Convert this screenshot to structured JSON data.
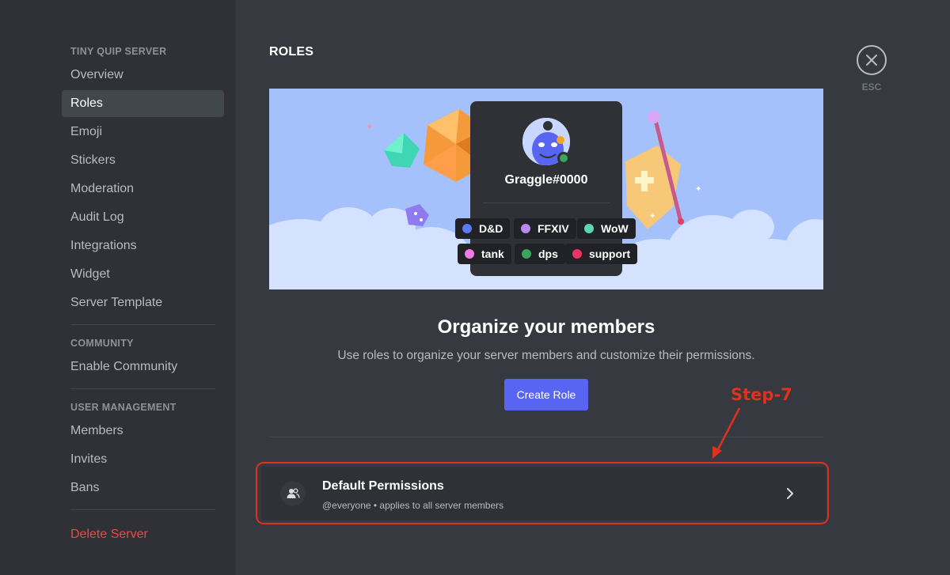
{
  "sidebar": {
    "sections": [
      {
        "header": "TINY QUIP SERVER",
        "items": [
          {
            "label": "Overview"
          },
          {
            "label": "Roles"
          },
          {
            "label": "Emoji"
          },
          {
            "label": "Stickers"
          },
          {
            "label": "Moderation"
          },
          {
            "label": "Audit Log"
          },
          {
            "label": "Integrations"
          },
          {
            "label": "Widget"
          },
          {
            "label": "Server Template"
          }
        ]
      },
      {
        "header": "COMMUNITY",
        "items": [
          {
            "label": "Enable Community"
          }
        ]
      },
      {
        "header": "USER MANAGEMENT",
        "items": [
          {
            "label": "Members"
          },
          {
            "label": "Invites"
          },
          {
            "label": "Bans"
          }
        ]
      }
    ],
    "active_item": "Roles",
    "delete_label": "Delete Server"
  },
  "main": {
    "title": "ROLES",
    "close_label": "ESC",
    "banner": {
      "username": "Graggle#0000",
      "roles": [
        {
          "name": "D&D",
          "color": "#5c7cf4"
        },
        {
          "name": "FFXIV",
          "color": "#b88af0"
        },
        {
          "name": "WoW",
          "color": "#5fd4b4"
        },
        {
          "name": "tank",
          "color": "#f47ae4"
        },
        {
          "name": "dps",
          "color": "#3ba55c"
        },
        {
          "name": "support",
          "color": "#ed3264"
        }
      ]
    },
    "heading": "Organize your members",
    "subtext": "Use roles to organize your server members and customize their permissions.",
    "create_button": "Create Role",
    "default_permissions": {
      "title": "Default Permissions",
      "subtitle": "@everyone • applies to all server members"
    },
    "annotation": {
      "label": "Step-7",
      "color": "#e0301e"
    }
  },
  "colors": {
    "sidebar_bg": "#2f3136",
    "main_bg": "#36393f",
    "accent": "#5865f2",
    "danger": "#f04747",
    "banner_bg": "#a4c1fb"
  }
}
